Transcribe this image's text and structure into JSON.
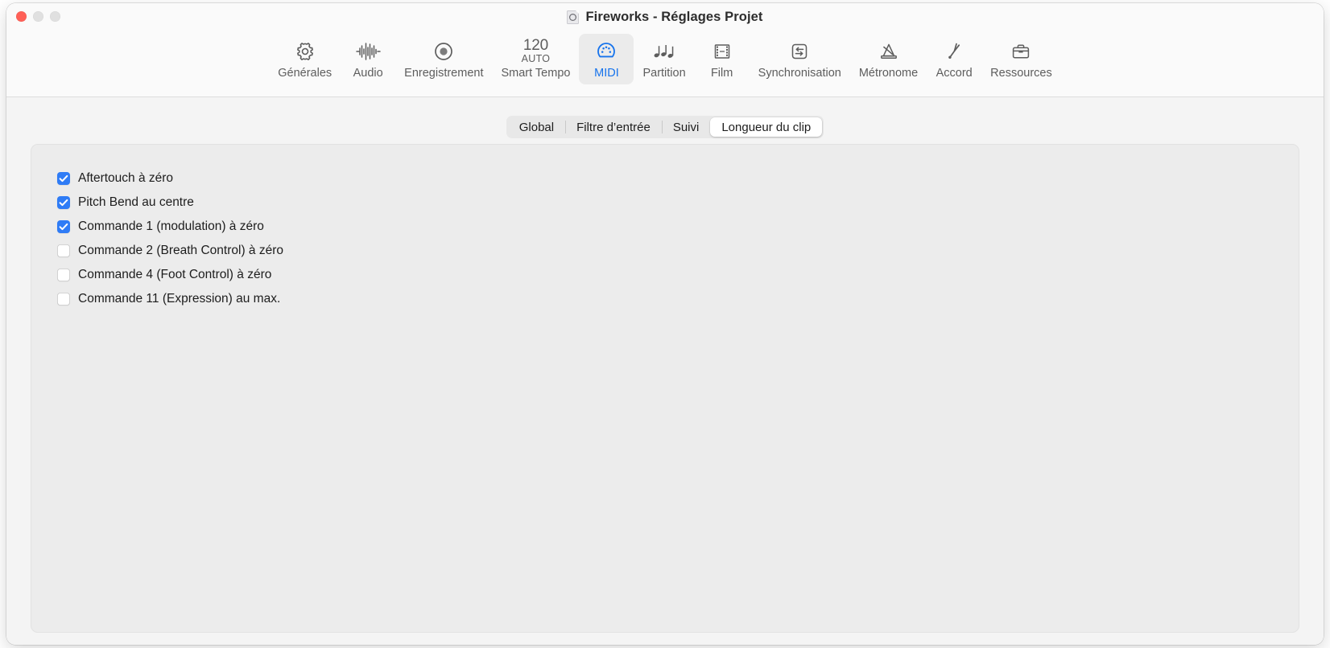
{
  "window": {
    "title": "Fireworks - Réglages Projet",
    "doc_icon": "midi-document-icon",
    "traffic_lights": {
      "close": "close-button",
      "minimize": "minimize-button",
      "zoom": "zoom-button"
    }
  },
  "toolbar": {
    "items": [
      {
        "label": "Générales",
        "icon": "gear-icon",
        "selected": false
      },
      {
        "label": "Audio",
        "icon": "waveform-icon",
        "selected": false
      },
      {
        "label": "Enregistrement",
        "icon": "record-icon",
        "selected": false
      },
      {
        "label": "Smart Tempo",
        "icon": "smart-tempo-icon",
        "selected": false,
        "tempo_value": "120",
        "tempo_mode": "AUTO"
      },
      {
        "label": "MIDI",
        "icon": "midi-connector-icon",
        "selected": true
      },
      {
        "label": "Partition",
        "icon": "musical-notes-icon",
        "selected": false
      },
      {
        "label": "Film",
        "icon": "film-strip-icon",
        "selected": false
      },
      {
        "label": "Synchronisation",
        "icon": "sync-arrows-icon",
        "selected": false
      },
      {
        "label": "Métronome",
        "icon": "metronome-icon",
        "selected": false
      },
      {
        "label": "Accord",
        "icon": "tuning-fork-icon",
        "selected": false
      },
      {
        "label": "Ressources",
        "icon": "briefcase-icon",
        "selected": false
      }
    ]
  },
  "segmented_control": {
    "tabs": [
      {
        "label": "Global",
        "active": false
      },
      {
        "label": "Filtre d’entrée",
        "active": false
      },
      {
        "label": "Suivi",
        "active": false
      },
      {
        "label": "Longueur du clip",
        "active": true
      }
    ]
  },
  "panel": {
    "checkboxes": [
      {
        "label": "Aftertouch à zéro",
        "checked": true
      },
      {
        "label": "Pitch Bend au centre",
        "checked": true
      },
      {
        "label": "Commande 1 (modulation) à zéro",
        "checked": true
      },
      {
        "label": "Commande 2 (Breath Control) à zéro",
        "checked": false
      },
      {
        "label": "Commande 4 (Foot Control) à zéro",
        "checked": false
      },
      {
        "label": "Commande 11 (Expression) au max.",
        "checked": false
      }
    ]
  },
  "colors": {
    "accent_blue": "#2f7cf6",
    "selected_label_blue": "#1673ec",
    "toolbar_bg": "#fafafa",
    "body_bg": "#f4f4f4",
    "panel_bg": "#ececec",
    "close_red": "#ff6057"
  }
}
